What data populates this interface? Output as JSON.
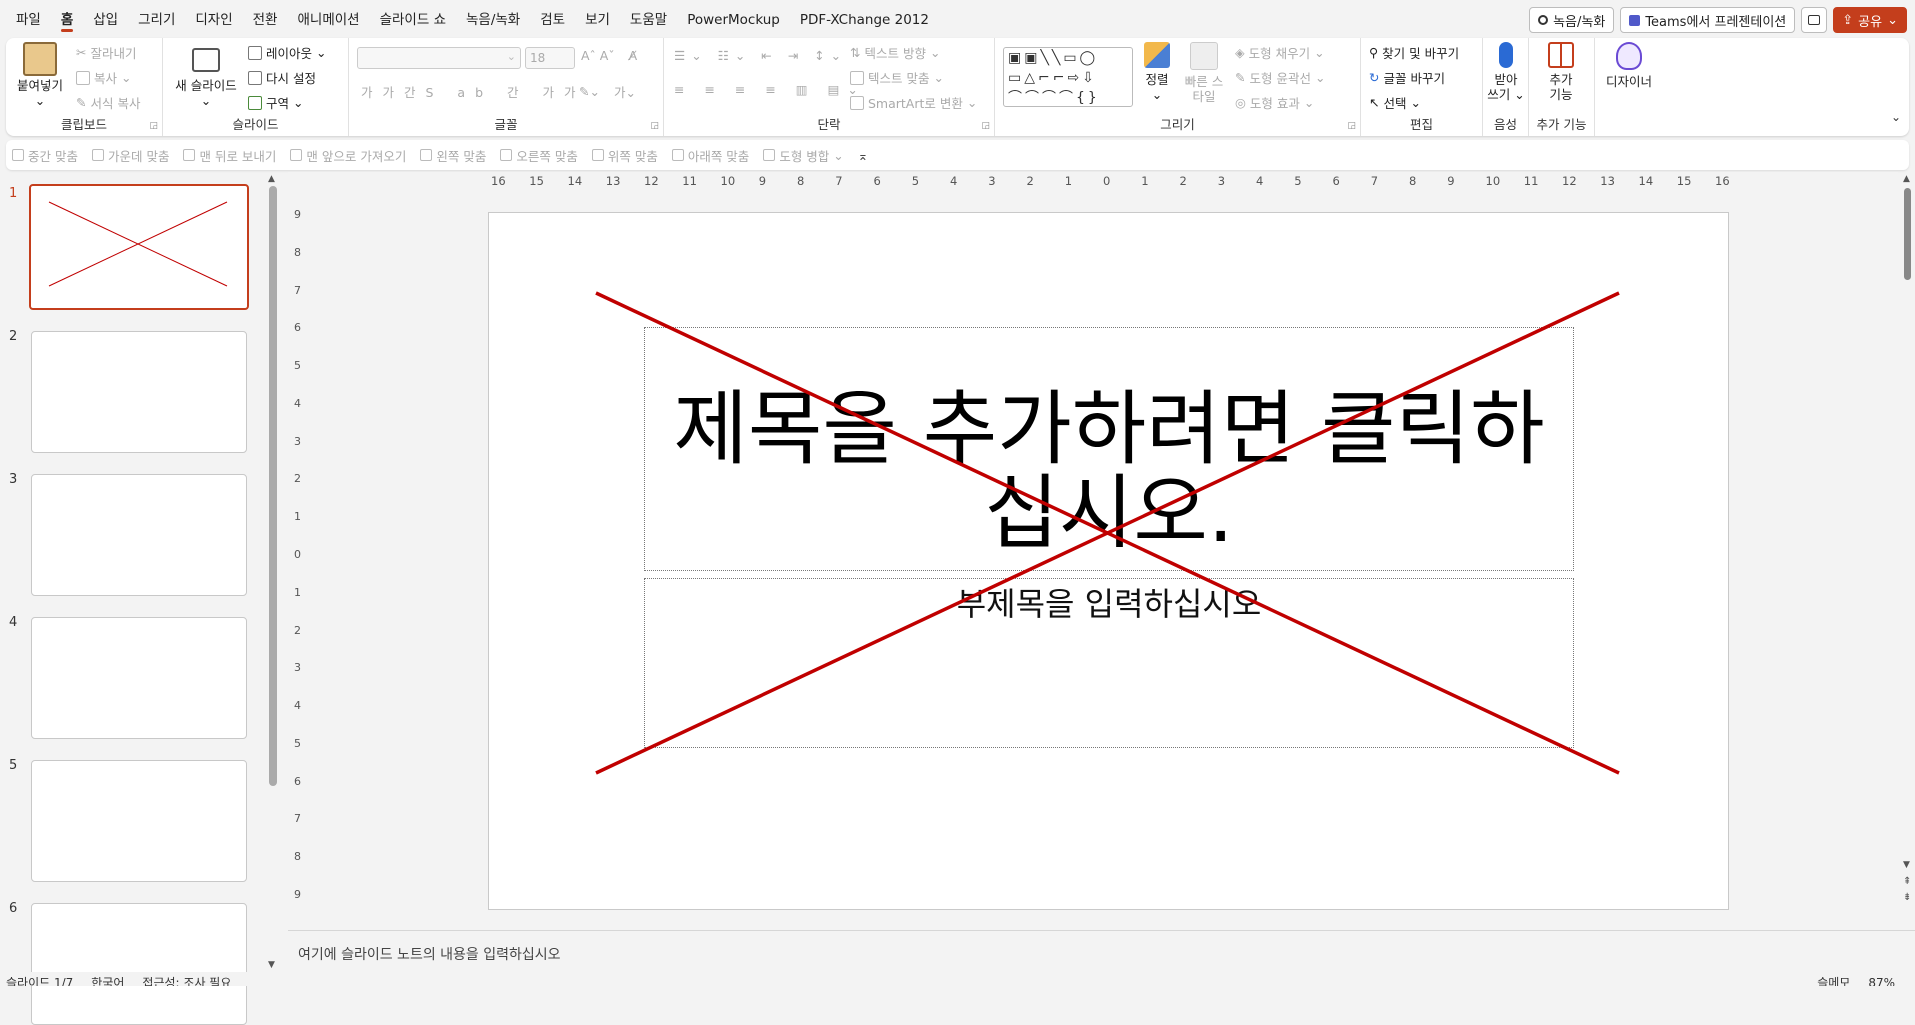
{
  "menu": {
    "items": [
      "파일",
      "홈",
      "삽입",
      "그리기",
      "디자인",
      "전환",
      "애니메이션",
      "슬라이드 쇼",
      "녹음/녹화",
      "검토",
      "보기",
      "도움말",
      "PowerMockup",
      "PDF-XChange 2012"
    ],
    "active_index": 1
  },
  "topright": {
    "record": "녹음/녹화",
    "teams": "Teams에서 프레젠테이션",
    "share": "공유"
  },
  "ribbon": {
    "clipboard": {
      "paste": "붙여넣기",
      "cut": "잘라내기",
      "copy": "복사",
      "format_painter": "서식 복사",
      "label": "클립보드"
    },
    "slides": {
      "new_slide": "새 슬라이드",
      "layout": "레이아웃",
      "reset": "다시 설정",
      "section": "구역",
      "label": "슬라이드"
    },
    "font": {
      "size": "18",
      "label": "글꼴"
    },
    "paragraph": {
      "text_direction": "텍스트 방향",
      "align_text": "텍스트 맞춤",
      "smartart": "SmartArt로 변환",
      "label": "단락"
    },
    "drawing": {
      "arrange": "정렬",
      "quick_styles": "빠른 스타일",
      "shape_fill": "도형 채우기",
      "shape_outline": "도형 윤곽선",
      "shape_effects": "도형 효과",
      "label": "그리기"
    },
    "editing": {
      "find_replace": "찾기 및 바꾸기",
      "replace_font": "글꼴 바꾸기",
      "select": "선택",
      "label": "편집"
    },
    "voice": {
      "dictate": "받아\n쓰기",
      "label": "음성"
    },
    "addins": {
      "addins": "추가\n기능",
      "label": "추가 기능"
    },
    "designer": {
      "designer": "디자이너"
    }
  },
  "ribbon2": {
    "items": [
      "중간 맞춤",
      "가운데 맞춤",
      "맨 뒤로 보내기",
      "맨 앞으로 가져오기",
      "왼쪽 맞춤",
      "오른쪽 맞춤",
      "위쪽 맞춤",
      "아래쪽 맞춤",
      "도형 병합"
    ]
  },
  "ruler": {
    "h_ticks": [
      "16",
      "15",
      "14",
      "13",
      "12",
      "11",
      "10",
      "9",
      "8",
      "7",
      "6",
      "5",
      "4",
      "3",
      "2",
      "1",
      "0",
      "1",
      "2",
      "3",
      "4",
      "5",
      "6",
      "7",
      "8",
      "9",
      "10",
      "11",
      "12",
      "13",
      "14",
      "15",
      "16"
    ],
    "v_ticks": [
      "9",
      "8",
      "7",
      "6",
      "5",
      "4",
      "3",
      "2",
      "1",
      "0",
      "1",
      "2",
      "3",
      "4",
      "5",
      "6",
      "7",
      "8",
      "9"
    ]
  },
  "thumbnails": {
    "numbers": [
      "1",
      "2",
      "3",
      "4",
      "5",
      "6"
    ],
    "selected_index": 0
  },
  "slide": {
    "title_placeholder": "제목을 추가하려면 클릭하십시오.",
    "subtitle_placeholder": "부제목을 입력하십시오",
    "cross_color": "#c00000"
  },
  "notes": {
    "placeholder": "여기에 슬라이드 노트의 내용을 입력하십시오"
  },
  "status": {
    "slide": "슬라이드 1/7",
    "language": "한국어",
    "accessibility": "접근성: 조사 필요",
    "notes": "슬메모",
    "zoom": "87%"
  },
  "colors": {
    "accent": "#c43e1c"
  }
}
